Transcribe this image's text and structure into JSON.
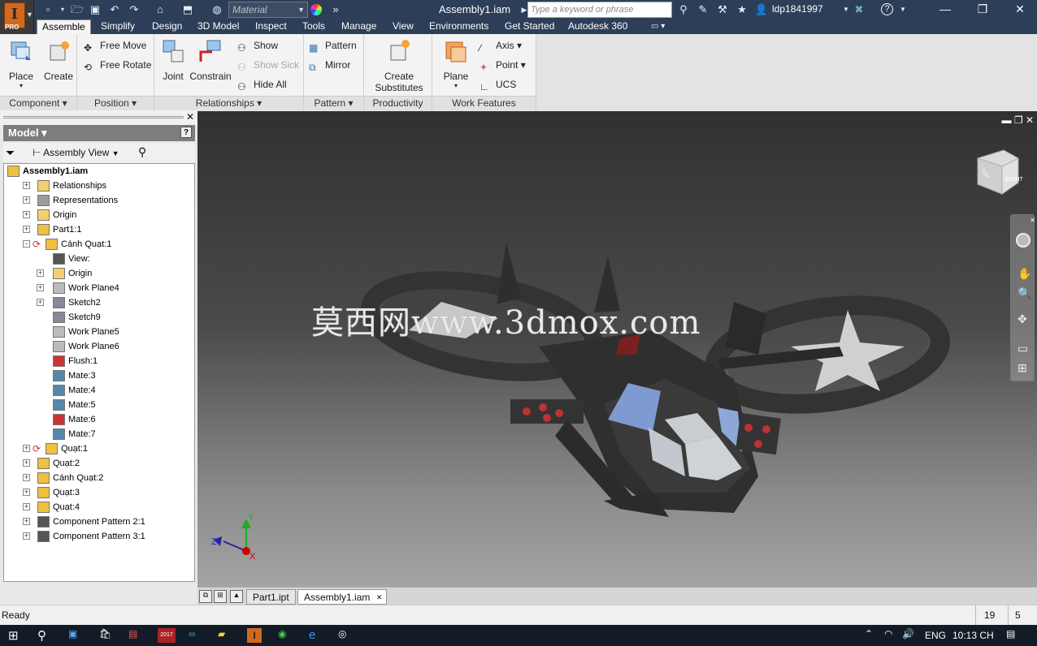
{
  "title_bar": {
    "document_title": "Assembly1.iam",
    "material_placeholder": "Material",
    "search_placeholder": "Type a keyword or phrase",
    "username": "ldp1841997",
    "app_badge": "PRO"
  },
  "menu_tabs": [
    "Assemble",
    "Simplify",
    "Design",
    "3D Model",
    "Inspect",
    "Tools",
    "Manage",
    "View",
    "Environments",
    "Get Started",
    "Autodesk 360"
  ],
  "ribbon": {
    "component": {
      "title": "Component",
      "place": "Place",
      "create": "Create"
    },
    "position": {
      "title": "Position",
      "free_move": "Free Move",
      "free_rotate": "Free Rotate"
    },
    "relationships": {
      "title": "Relationships",
      "joint": "Joint",
      "constrain": "Constrain",
      "show": "Show",
      "show_sick": "Show Sick",
      "hide_all": "Hide All"
    },
    "pattern": {
      "title": "Pattern",
      "pattern": "Pattern",
      "mirror": "Mirror"
    },
    "productivity": {
      "title": "Productivity",
      "create_substitutes_1": "Create",
      "create_substitutes_2": "Substitutes"
    },
    "work_features": {
      "title": "Work Features",
      "plane": "Plane",
      "axis": "Axis",
      "point": "Point",
      "ucs": "UCS"
    }
  },
  "browser": {
    "header": "Model",
    "view": "Assembly View",
    "help": "?",
    "tree": [
      {
        "label": "Assembly1.iam",
        "bold": true
      },
      {
        "label": "Relationships"
      },
      {
        "label": "Representations"
      },
      {
        "label": "Origin"
      },
      {
        "label": "Part1:1"
      },
      {
        "label": "Cánh Quạt:1"
      },
      {
        "label": "View:"
      },
      {
        "label": "Origin"
      },
      {
        "label": "Work Plane4"
      },
      {
        "label": "Sketch2"
      },
      {
        "label": "Sketch9"
      },
      {
        "label": "Work Plane5"
      },
      {
        "label": "Work Plane6"
      },
      {
        "label": "Flush:1"
      },
      {
        "label": "Mate:3"
      },
      {
        "label": "Mate:4"
      },
      {
        "label": "Mate:5"
      },
      {
        "label": "Mate:6"
      },
      {
        "label": "Mate:7"
      },
      {
        "label": "Quạt:1"
      },
      {
        "label": "Quạt:2"
      },
      {
        "label": "Cánh Quạt:2"
      },
      {
        "label": "Quạt:3"
      },
      {
        "label": "Quạt:4"
      },
      {
        "label": "Component Pattern 2:1"
      },
      {
        "label": "Component Pattern 3:1"
      }
    ]
  },
  "viewport": {
    "watermark": "莫西网www.3dmox.com",
    "viewcube_face_1": "RIGHT",
    "viewcube_face_2": "TOP",
    "axis_x": "X",
    "axis_y": "Y",
    "axis_z": "Z"
  },
  "doc_tabs": [
    {
      "label": "Part1.ipt"
    },
    {
      "label": "Assembly1.iam",
      "active": true
    }
  ],
  "status": {
    "text": "Ready",
    "count1": "19",
    "count2": "5"
  },
  "taskbar": {
    "lang": "ENG",
    "time": "10:13 CH",
    "year_badge": "2017"
  },
  "colors": {
    "titlebar": "#2c3e58",
    "ribbon": "#f3f3f3",
    "accent_orange": "#d2691e",
    "taskbar": "#121b26"
  }
}
